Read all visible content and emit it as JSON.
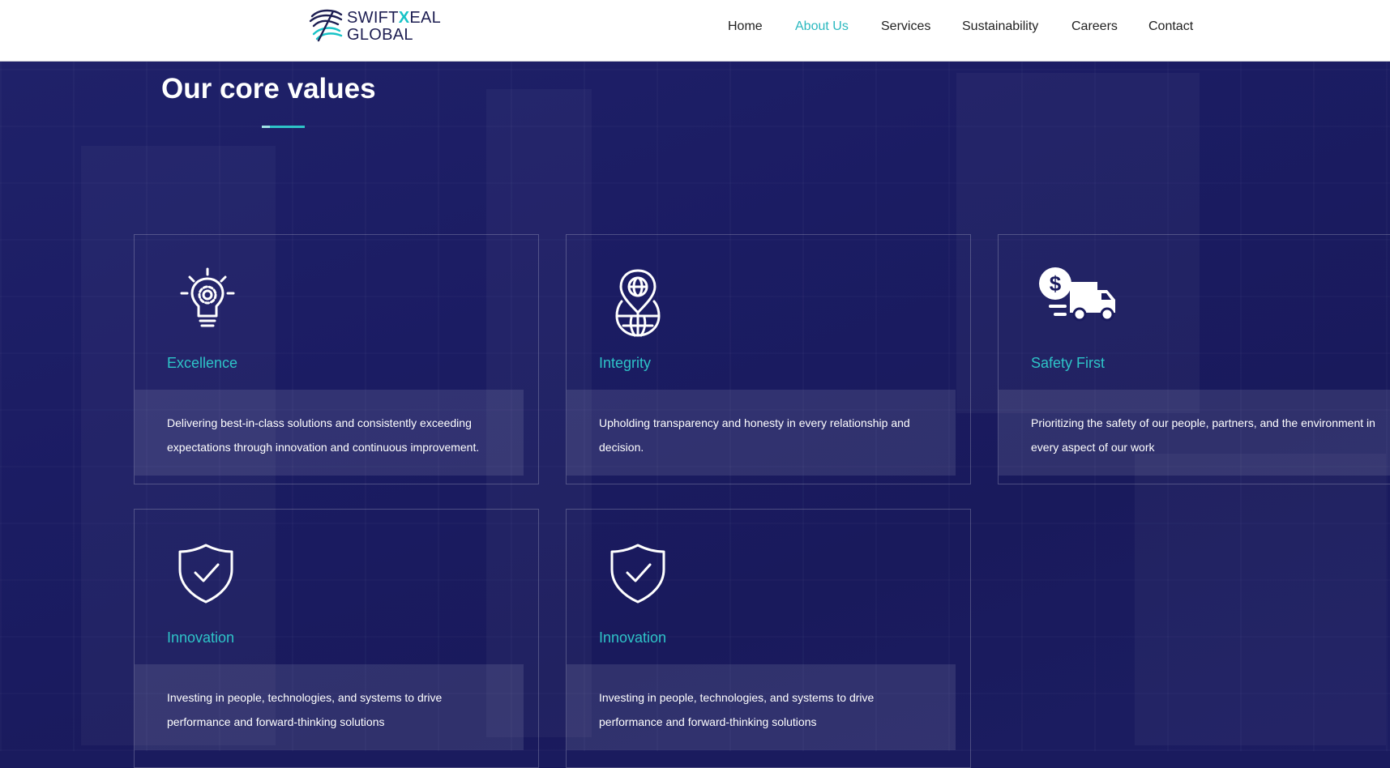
{
  "header": {
    "logo_text_top_1": "SWIFT",
    "logo_text_top_2": "X",
    "logo_text_top_3": "EAL",
    "logo_text_bottom": "GLOBAL",
    "nav": [
      {
        "label": "Home",
        "active": false
      },
      {
        "label": "About Us",
        "active": true
      },
      {
        "label": "Services",
        "active": false
      },
      {
        "label": "Sustainability",
        "active": false
      },
      {
        "label": "Careers",
        "active": false
      },
      {
        "label": "Contact",
        "active": false
      }
    ]
  },
  "section": {
    "title": "Our core values"
  },
  "cards": [
    {
      "icon": "lightbulb-gear-icon",
      "title": "Excellence",
      "text": "Delivering best-in-class solutions and consistently exceeding expectations through innovation and continuous improvement."
    },
    {
      "icon": "globe-pin-icon",
      "title": "Integrity",
      "text": "Upholding transparency and honesty in every relationship and decision."
    },
    {
      "icon": "dollar-truck-icon",
      "title": "Safety First",
      "text": "Prioritizing the safety of our people, partners, and the environment in every aspect of our work"
    },
    {
      "icon": "shield-check-icon",
      "title": "Innovation",
      "text": "Investing in people, technologies, and systems to drive performance and forward-thinking solutions"
    },
    {
      "icon": "shield-check-icon",
      "title": "Innovation",
      "text": "Investing in people, technologies, and systems to drive performance and forward-thinking solutions"
    }
  ],
  "colors": {
    "accent": "#2ec4c8",
    "background": "#1a1b5e",
    "header_bg": "#ffffff",
    "active_nav": "#2ab8bf"
  }
}
